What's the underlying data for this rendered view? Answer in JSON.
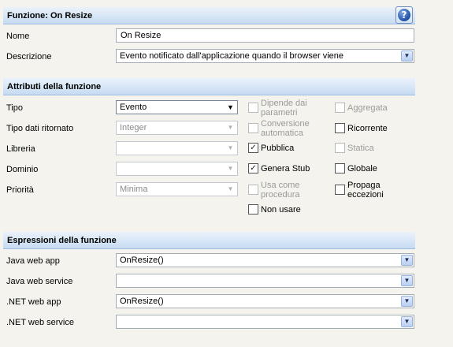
{
  "function_section": {
    "header": "Funzione: On Resize",
    "help_icon": "help-icon",
    "name_label": "Nome",
    "name_value": "On Resize",
    "description_label": "Descrizione",
    "description_value": "Evento notificato dall'applicazione quando il browser viene"
  },
  "attributes_section": {
    "header": "Attributi della funzione",
    "fields": {
      "tipo_label": "Tipo",
      "tipo_value": "Evento",
      "tipo_dati_label": "Tipo dati ritornato",
      "tipo_dati_value": "Integer",
      "libreria_label": "Libreria",
      "libreria_value": "",
      "dominio_label": "Dominio",
      "dominio_value": "",
      "priorita_label": "Priorità",
      "priorita_value": "Minima"
    },
    "checkboxes": {
      "dipende": {
        "label": "Dipende dai parametri",
        "checked": false,
        "enabled": false
      },
      "conversione": {
        "label": "Conversione automatica",
        "checked": false,
        "enabled": false
      },
      "pubblica": {
        "label": "Pubblica",
        "checked": true,
        "enabled": true
      },
      "genera_stub": {
        "label": "Genera Stub",
        "checked": true,
        "enabled": true
      },
      "usa_come": {
        "label": "Usa come procedura",
        "checked": false,
        "enabled": false
      },
      "non_usare": {
        "label": "Non usare",
        "checked": false,
        "enabled": true
      },
      "aggregata": {
        "label": "Aggregata",
        "checked": false,
        "enabled": false
      },
      "ricorrente": {
        "label": "Ricorrente",
        "checked": false,
        "enabled": true
      },
      "statica": {
        "label": "Statica",
        "checked": false,
        "enabled": false
      },
      "globale": {
        "label": "Globale",
        "checked": false,
        "enabled": true
      },
      "propaga": {
        "label": "Propaga eccezioni",
        "checked": false,
        "enabled": true
      }
    }
  },
  "expressions_section": {
    "header": "Espressioni della funzione",
    "java_web_app_label": "Java web app",
    "java_web_app_value": "OnResize()",
    "java_web_service_label": "Java web service",
    "java_web_service_value": "",
    "net_web_app_label": ".NET web app",
    "net_web_app_value": "OnResize()",
    "net_web_service_label": ".NET web service",
    "net_web_service_value": ""
  },
  "glyphs": {
    "dropdown_arrow": "▼",
    "check_mark": "✓",
    "help": "?"
  },
  "colors": {
    "header_gradient_top": "#eaf2fb",
    "header_gradient_bottom": "#c6daf1",
    "background": "#f4f3ee"
  }
}
